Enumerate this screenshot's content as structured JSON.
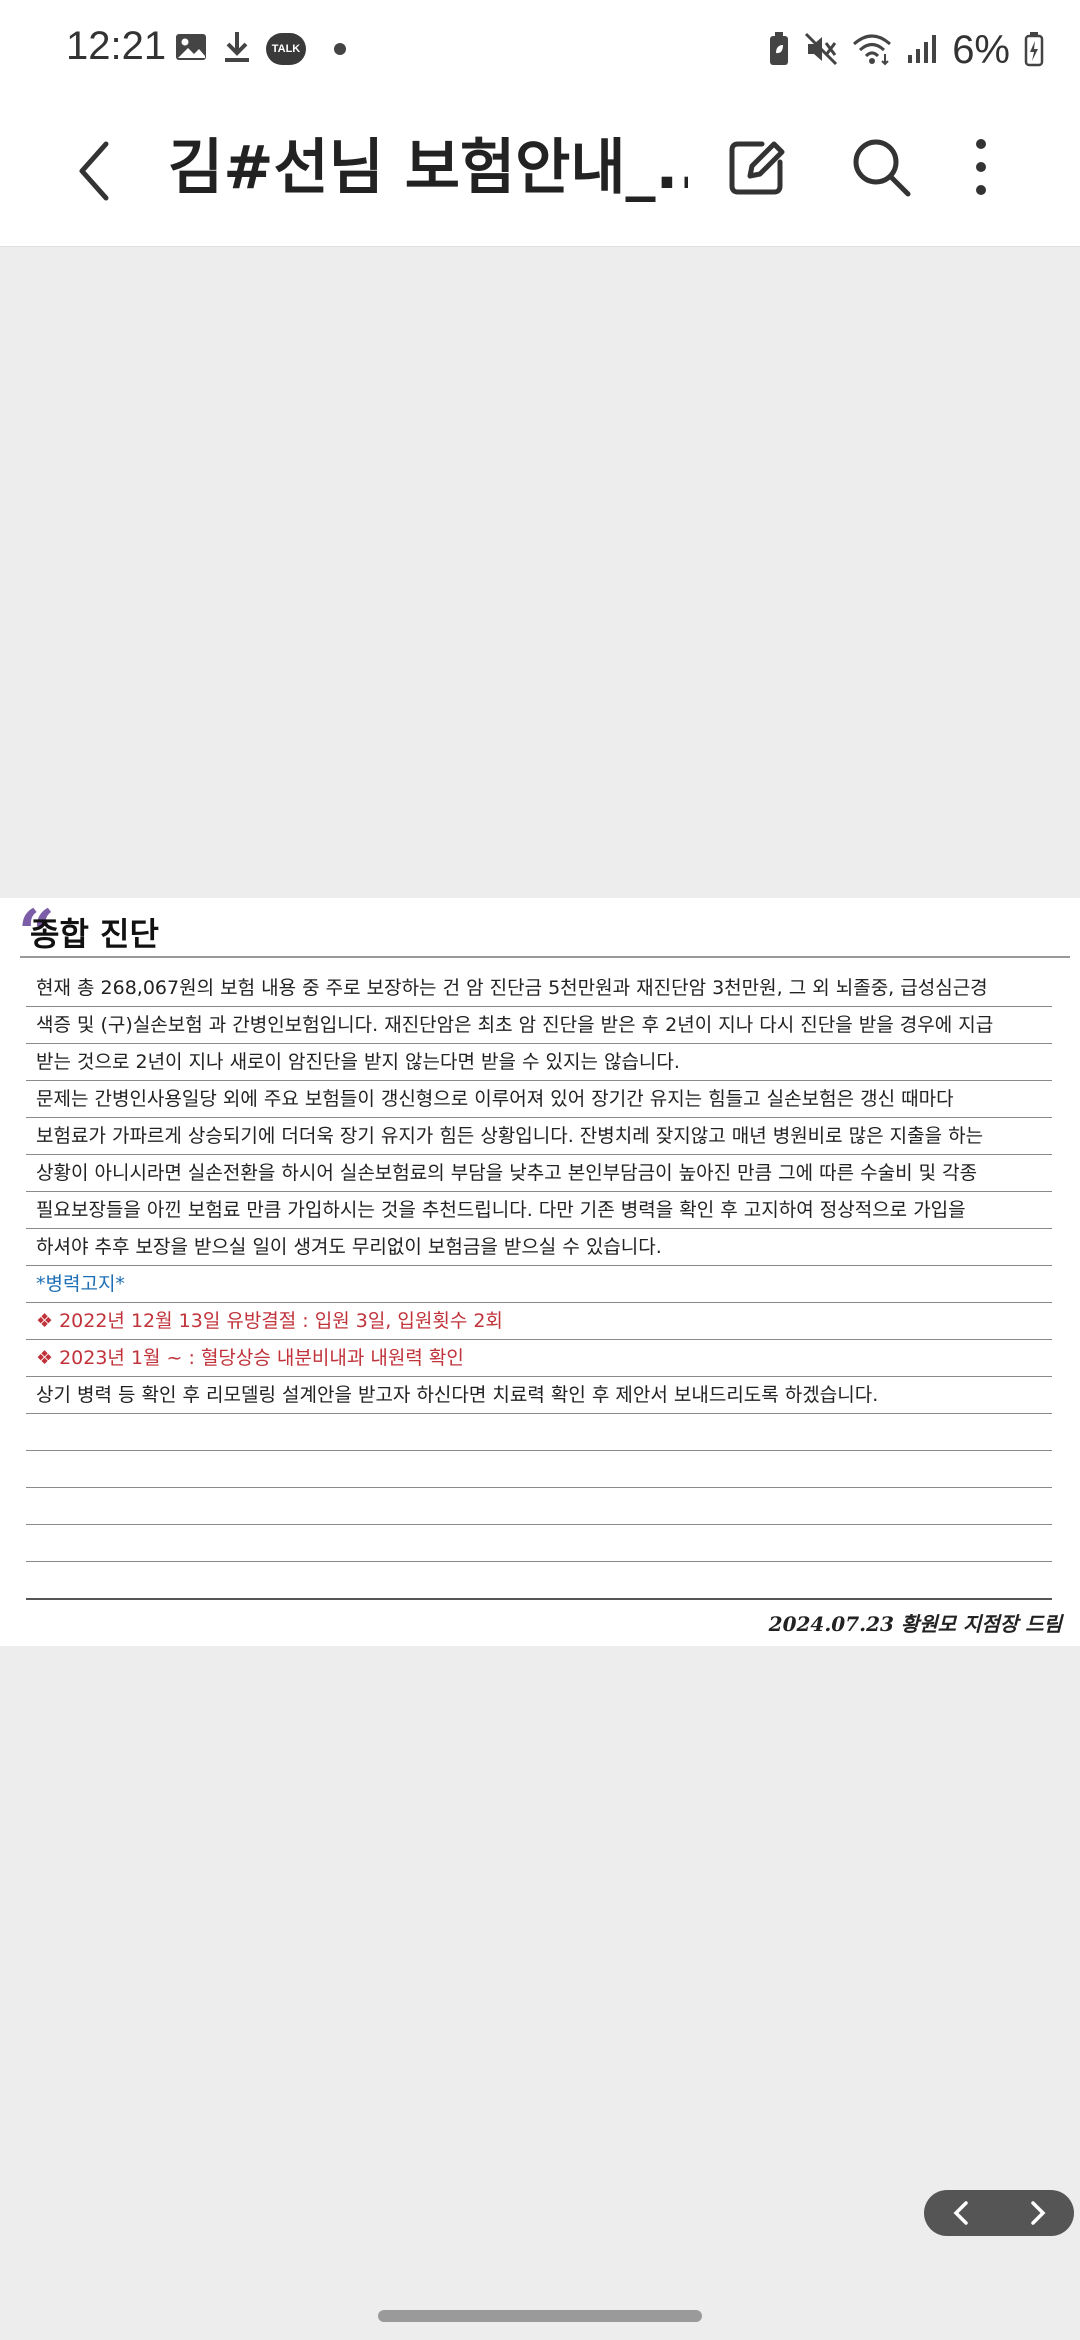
{
  "status_bar": {
    "time": "12:21",
    "battery": "6%",
    "talk_badge": "TALK",
    "icons": [
      "image-icon",
      "download-icon",
      "kakaotalk-icon",
      "dot-icon",
      "battery-saver-icon",
      "mute-icon",
      "wifi-icon",
      "signal-icon",
      "battery-icon"
    ]
  },
  "appbar": {
    "title": "김#선님 보험안내_...",
    "icons": [
      "back-icon",
      "edit-icon",
      "search-icon",
      "more-icon"
    ]
  },
  "document": {
    "heading": "종합 진단",
    "accent_color": "#7b5ea7",
    "lines": [
      {
        "text": " 현재 총 268,067원의 보험 내용 중 주로 보장하는 건 암 진단금 5천만원과 재진단암 3천만원, 그 외 뇌졸중, 급성심근경",
        "style": "normal"
      },
      {
        "text": "색증 및 (구)실손보험 과 간병인보험입니다. 재진단암은 최초 암 진단을 받은 후 2년이 지나 다시 진단을 받을 경우에 지급",
        "style": "normal"
      },
      {
        "text": "받는 것으로 2년이 지나 새로이 암진단을 받지 않는다면 받을 수 있지는 않습니다.",
        "style": "normal"
      },
      {
        "text": " 문제는 간병인사용일당 외에 주요 보험들이 갱신형으로 이루어져 있어 장기간 유지는 힘들고 실손보험은 갱신 때마다",
        "style": "normal"
      },
      {
        "text": "보험료가 가파르게 상승되기에 더더욱 장기 유지가 힘든 상황입니다. 잔병치레 잦지않고 매년 병원비로 많은 지출을 하는",
        "style": "normal"
      },
      {
        "text": "상황이 아니시라면 실손전환을 하시어 실손보험료의 부담을 낮추고 본인부담금이 높아진 만큼 그에 따른 수술비 및 각종",
        "style": "normal"
      },
      {
        "text": "필요보장들을 아낀 보험료 만큼 가입하시는 것을 추천드립니다. 다만 기존 병력을 확인 후 고지하여 정상적으로 가입을",
        "style": "normal"
      },
      {
        "text": "하셔야 추후 보장을 받으실 일이 생겨도 무리없이 보험금을 받으실 수 있습니다.",
        "style": "normal"
      },
      {
        "text": " *병력고지*",
        "style": "blue"
      },
      {
        "text": "❖ 2022년 12월 13일  유방결절 : 입원 3일, 입원횟수 2회",
        "style": "red"
      },
      {
        "text": "❖ 2023년 1월 ~ : 혈당상승 내분비내과 내원력 확인",
        "style": "red"
      },
      {
        "text": "상기 병력 등 확인 후 리모델링 설계안을 받고자 하신다면 치료력 확인 후 제안서 보내드리도록 하겠습니다.",
        "style": "normal"
      },
      {
        "text": "",
        "style": "normal"
      },
      {
        "text": "",
        "style": "normal"
      },
      {
        "text": "",
        "style": "normal"
      },
      {
        "text": "",
        "style": "normal"
      },
      {
        "text": "",
        "style": "last"
      }
    ],
    "signature": "2024.07.23   황원모 지점장 드림"
  },
  "pager": {
    "icons": [
      "chevron-left-icon",
      "chevron-right-icon"
    ]
  }
}
